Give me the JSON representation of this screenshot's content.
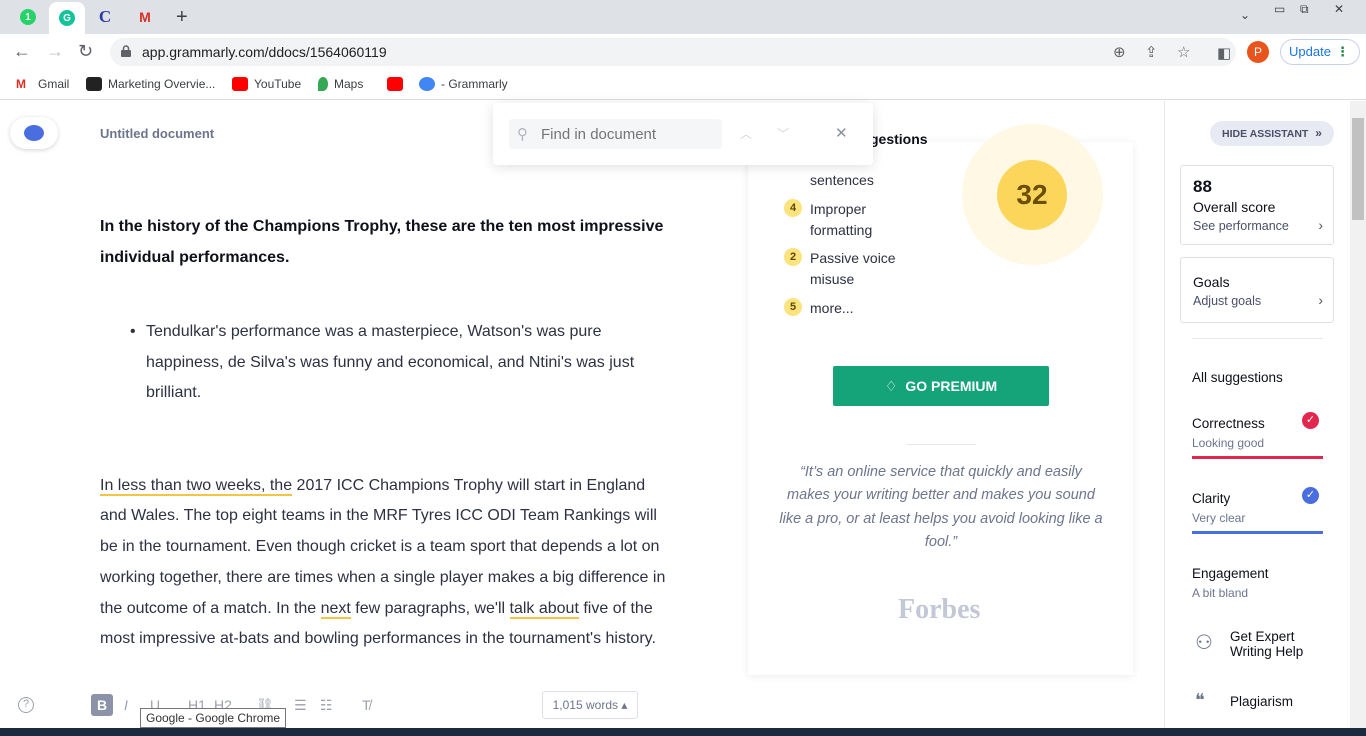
{
  "browser": {
    "url": "app.grammarly.com/ddocs/1564060119",
    "update_label": "Update",
    "profile_initial": "P",
    "tabs": [
      {
        "icon": "whatsapp-icon",
        "glyph": "1",
        "color": "#25d366"
      },
      {
        "icon": "grammarly-icon",
        "glyph": "G",
        "color": "#15c39a"
      },
      {
        "icon": "c-icon",
        "glyph": "C",
        "color": "#2a3cab"
      },
      {
        "icon": "gmail-icon",
        "glyph": "M",
        "color": "#d93025"
      }
    ],
    "bookmarks": [
      {
        "label": "Gmail",
        "icon": "gmail-icon",
        "color": "#d93025"
      },
      {
        "label": "Marketing Overvie...",
        "icon": "marketing-icon",
        "color": "#222222"
      },
      {
        "label": "YouTube",
        "icon": "youtube-icon",
        "color": "#ff0000"
      },
      {
        "label": "Maps",
        "icon": "maps-icon",
        "color": "#34a853"
      },
      {
        "label": "",
        "icon": "youtube-icon",
        "color": "#ff0000"
      },
      {
        "label": "- Grammarly",
        "icon": "chrome-icon",
        "color": "#4285f4"
      }
    ]
  },
  "editor": {
    "doc_title": "Untitled document",
    "find_placeholder": "Find in document",
    "heading": "In the history of the Champions Trophy, these are the ten most impressive individual performances.",
    "bullet": "Tendulkar's performance was a masterpiece, Watson's was pure happiness, de Silva's was funny and economical, and Ntini's was just brilliant.",
    "para": {
      "s1": "In less than two weeks, the",
      "s2": " 2017 ICC Champions Trophy will start in England and Wales. The top eight teams in the MRF Tyres ICC ODI Team Rankings will be in the tournament. Even though cricket is a team sport that depends a lot on working together, there are times when a single player makes a big difference in the outcome of a match. In the ",
      "s3": "next",
      "s4": " few paragraphs, we'll ",
      "s5": "talk about",
      "s6": " five of the most impressive at-bats and bowling performances in the tournament's history."
    },
    "toolbar": {
      "bold": "B",
      "italic": "I",
      "underline": "U",
      "h1": "H1",
      "h2": "H2",
      "word_count": "1,015 words ▴"
    },
    "tooltip": "Google - Google Chrome"
  },
  "suggestions": {
    "title_partial": "gestions",
    "issues": [
      {
        "num": "",
        "label": "sentences"
      },
      {
        "num": "4",
        "label": "Improper formatting"
      },
      {
        "num": "2",
        "label": "Passive voice misuse"
      },
      {
        "num": "5",
        "label": "more..."
      }
    ],
    "score": "32",
    "premium_label": "GO PREMIUM",
    "quote": "“It’s an online service that quickly and easily makes your writing better and makes you sound like a pro, or at least helps you avoid looking like a fool.”",
    "quote_source": "Forbes"
  },
  "sidebar": {
    "hide_label": "HIDE ASSISTANT",
    "overall_score": "88",
    "overall_label": "Overall score",
    "overall_link": "See performance",
    "goals_label": "Goals",
    "goals_link": "Adjust goals",
    "all_suggestions": "All suggestions",
    "categories": [
      {
        "label": "Correctness",
        "status": "Looking good",
        "color": "#e2264d"
      },
      {
        "label": "Clarity",
        "status": "Very clear",
        "color": "#4a6ee0"
      },
      {
        "label": "Engagement",
        "status": "A bit bland",
        "color": ""
      }
    ],
    "expert_label": "Get Expert Writing Help",
    "plagiarism_label": "Plagiarism"
  }
}
